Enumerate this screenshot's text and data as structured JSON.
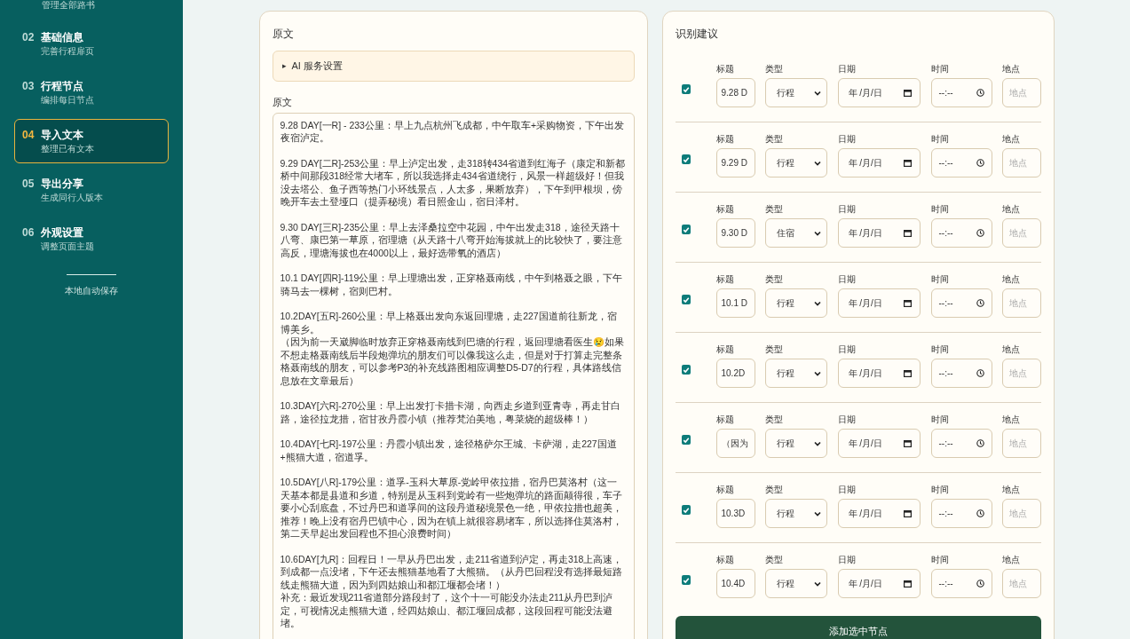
{
  "sidebar": {
    "top_caption": "管理全部路书",
    "items": [
      {
        "number": "02",
        "title": "基础信息",
        "subtitle": "完善行程扉页",
        "selected": false
      },
      {
        "number": "03",
        "title": "行程节点",
        "subtitle": "编排每日节点",
        "selected": false
      },
      {
        "number": "04",
        "title": "导入文本",
        "subtitle": "整理已有文本",
        "selected": true
      },
      {
        "number": "05",
        "title": "导出分享",
        "subtitle": "生成同行人版本",
        "selected": false
      },
      {
        "number": "06",
        "title": "外观设置",
        "subtitle": "调整页面主题",
        "selected": false
      }
    ],
    "footer": "本地自动保存"
  },
  "source_panel": {
    "heading": "原文",
    "ai_settings": {
      "marker": "▸",
      "label": "AI 服务设置",
      "expanded": false
    },
    "text_label": "原文",
    "text_paragraphs": [
      [
        "9.28 DAY[一R] - 233公里：早上九点杭州飞成都，中午取车+采购物资，下午出发夜宿泸定。"
      ],
      [
        "9.29 DAY[二R]-253公里：早上泸定出发，走318转434省道到红海子（康定和新都桥中间那段318经常大堵车，所以我选择走434省道绕行，风景一样超级好！但我没去塔公、鱼子西等热门小环线景点，人太多，果断放弃），下午到甲根坝，傍晚开车去土登垭口（提弄秘境）看日照金山，宿日泽村。"
      ],
      [
        "9.30 DAY[三R]-235公里：早上去泽桑拉空中花园，中午出发走318，途径天路十八弯、康巴第一草原，宿理塘（从天路十八弯开始海拔就上的比较快了，要注意高反，理塘海拔也在4000以上，最好选带氧的酒店）"
      ],
      [
        "10.1 DAY[四R]-119公里：早上理塘出发，正穿格聂南线，中午到格聂之眼，下午骑马去一棵树，宿则巴村。"
      ],
      [
        "10.2DAY[五R]-260公里：早上格聂出发向东返回理塘，走227国道前往新龙，宿博美乡。",
        "（因为前一天崴脚临时放弃正穿格聂南线到巴塘的行程，返回理塘看医生😢如果不想走格聂南线后半段炮弹坑的朋友们可以像我这么走，但是对于打算走完整条格聂南线的朋友，可以参考P3的补充线路图相应调整D5-D7的行程，具体路线信息放在文章最后）"
      ],
      [
        "10.3DAY[六R]-270公里：早上出发打卡措卡湖，向西走乡道到亚青寺，再走甘白路，途径拉龙措，宿甘孜丹霞小镇（推荐梵泊美地，粤菜烧的超级棒！）"
      ],
      [
        "10.4DAY[七R]-197公里：丹霞小镇出发，途径格萨尔王城、卡萨湖，走227国道+熊猫大道，宿道孚。"
      ],
      [
        "10.5DAY[八R]-179公里：道孚-玉科大草原-党岭甲依拉措，宿丹巴莫洛村（这一天基本都是县道和乡道，特别是从玉科到党岭有一些炮弹坑的路面颠得很，车子要小心刮底盘，不过丹巴和道孚间的这段丹道秘境景色一绝，甲依拉措也超美，推荐！晚上没有宿丹巴镇中心，因为在镇上就很容易堵车，所以选择住莫洛村，第二天早起出发回程也不担心浪费时间）"
      ],
      [
        "10.6DAY[九R]：回程日！一早从丹巴出发，走211省道到泸定，再走318上高速，到成都一点没堵，下午还去熊猫基地看了大熊猫。（从丹巴回程没有选择最短路线走熊猫大道，因为到四姑娘山和都江堰都会堵！）",
        "补充：最近发现211省道部分路段封了，这个十一可能没办法走211从丹巴到泸定，可视情况走熊猫大道，经四姑娘山、都江堰回成都，这段回程可能没法避堵。"
      ]
    ]
  },
  "suggestions_panel": {
    "heading": "识别建议",
    "rows": [
      {
        "checked": true,
        "labels": [
          "标题",
          "类型",
          "日期",
          "时间",
          "地点"
        ],
        "title": "9.28 D",
        "type": "行程",
        "date": "年 /月/日",
        "time": "--:--",
        "location_placeholder": "地点"
      },
      {
        "checked": true,
        "labels": [
          "标题",
          "类型",
          "日期",
          "时间",
          "地点"
        ],
        "title": "9.29 D",
        "type": "行程",
        "date": "年 /月/日",
        "time": "--:--",
        "location_placeholder": "地点"
      },
      {
        "checked": true,
        "labels": [
          "标题",
          "类型",
          "日期",
          "时间",
          "地点"
        ],
        "title": "9.30 D",
        "type": "住宿",
        "date": "年 /月/日",
        "time": "--:--",
        "location_placeholder": "地点"
      },
      {
        "checked": true,
        "labels": [
          "标题",
          "类型",
          "日期",
          "时间",
          "地点"
        ],
        "title": "10.1 D",
        "type": "行程",
        "date": "年 /月/日",
        "time": "--:--",
        "location_placeholder": "地点"
      },
      {
        "checked": true,
        "labels": [
          "标题",
          "类型",
          "日期",
          "时间",
          "地点"
        ],
        "title": "10.2D",
        "type": "行程",
        "date": "年 /月/日",
        "time": "--:--",
        "location_placeholder": "地点"
      },
      {
        "checked": true,
        "labels": [
          "标题",
          "类型",
          "日期",
          "时间",
          "地点"
        ],
        "title": "（因为",
        "type": "行程",
        "date": "年 /月/日",
        "time": "--:--",
        "location_placeholder": "地点"
      },
      {
        "checked": true,
        "labels": [
          "标题",
          "类型",
          "日期",
          "时间",
          "地点"
        ],
        "title": "10.3D",
        "type": "行程",
        "date": "年 /月/日",
        "time": "--:--",
        "location_placeholder": "地点"
      },
      {
        "checked": true,
        "labels": [
          "标题",
          "类型",
          "日期",
          "时间",
          "地点"
        ],
        "title": "10.4D",
        "type": "行程",
        "date": "年 /月/日",
        "time": "--:--",
        "location_placeholder": "地点"
      }
    ],
    "add_button": "添加选中节点"
  }
}
